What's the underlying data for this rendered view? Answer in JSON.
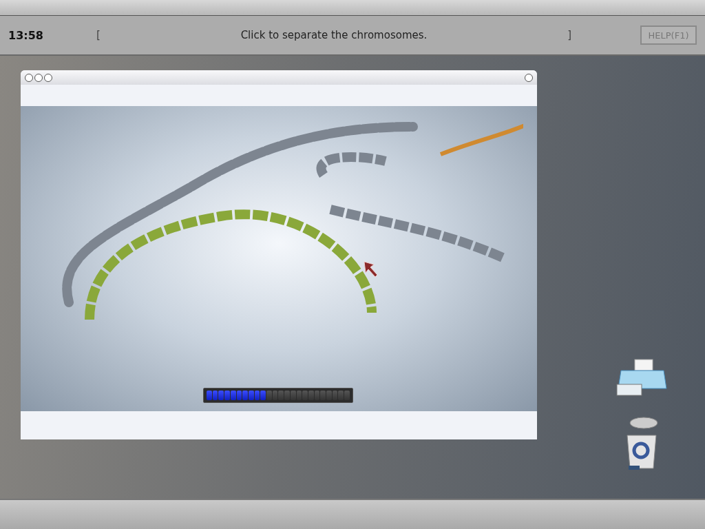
{
  "top_bar": {
    "time": "13:58",
    "open_bracket": "[",
    "message": "Click to separate the chromosomes.",
    "close_bracket": "]",
    "help_button": "HELP(F1)"
  },
  "viewer": {
    "progress": {
      "level": 0.417
    }
  }
}
